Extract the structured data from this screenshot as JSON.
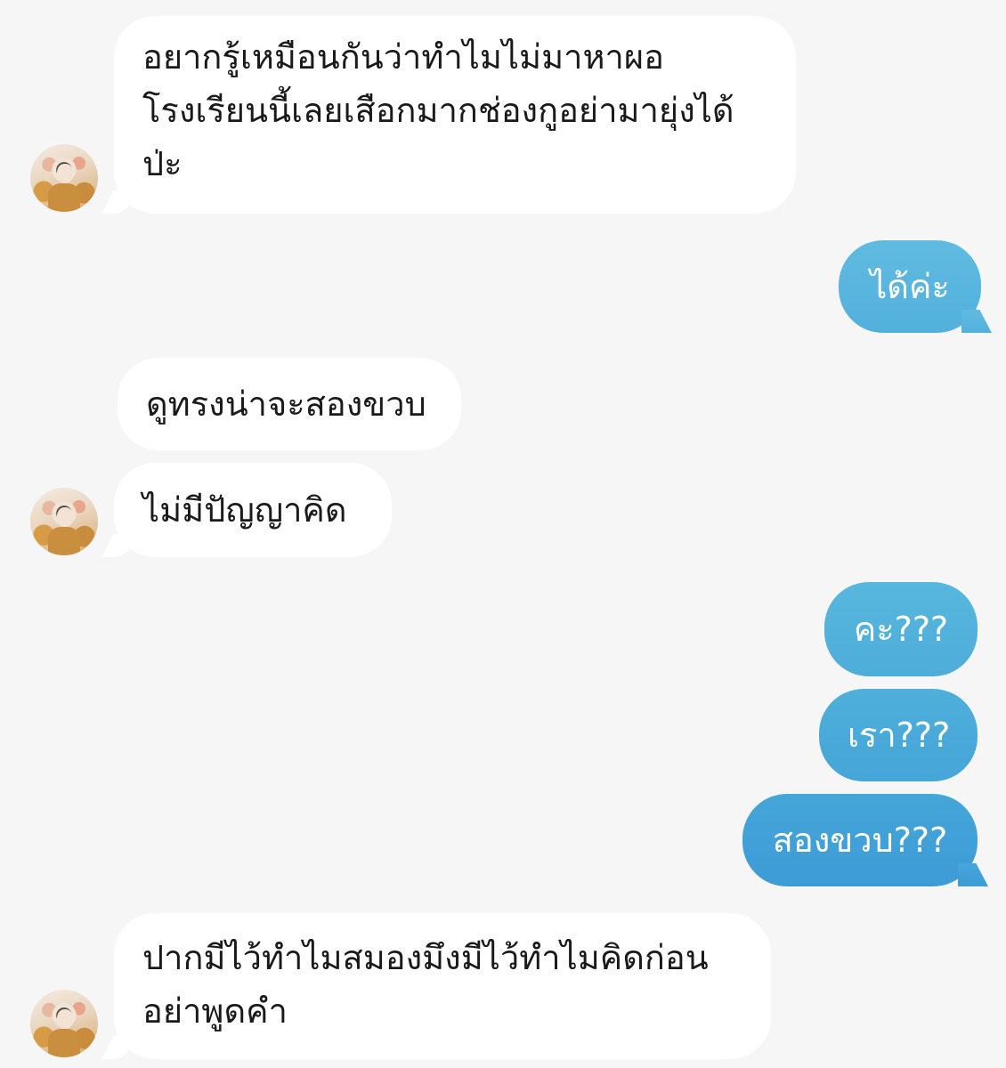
{
  "messages": [
    {
      "sender": "other",
      "text": "อยากรู้เหมือนกันว่าทำไมไม่มาหาผอ\nโรงเรียนนี้เลยเสือกมากช่องกูอย่ามายุ่งได้\nป่ะ"
    },
    {
      "sender": "me",
      "text": "ได้ค่ะ"
    },
    {
      "sender": "other",
      "text": "ดูทรงน่าจะสองขวบ"
    },
    {
      "sender": "other",
      "text": "ไม่มีปัญญาคิด"
    },
    {
      "sender": "me",
      "text": "คะ???"
    },
    {
      "sender": "me",
      "text": "เรา???"
    },
    {
      "sender": "me",
      "text": "สองขวบ???"
    },
    {
      "sender": "other",
      "text": "ปากมีไว้ทำไมสมองมึงมีไว้ทำไมคิดก่อน\nอย่าพูดคำ"
    }
  ],
  "colors": {
    "background": "#f6f6f6",
    "incoming_bubble": "#ffffff",
    "outgoing_bubble_gradient_top": "#5ab8dd",
    "outgoing_bubble_gradient_bottom": "#3d98d8"
  }
}
